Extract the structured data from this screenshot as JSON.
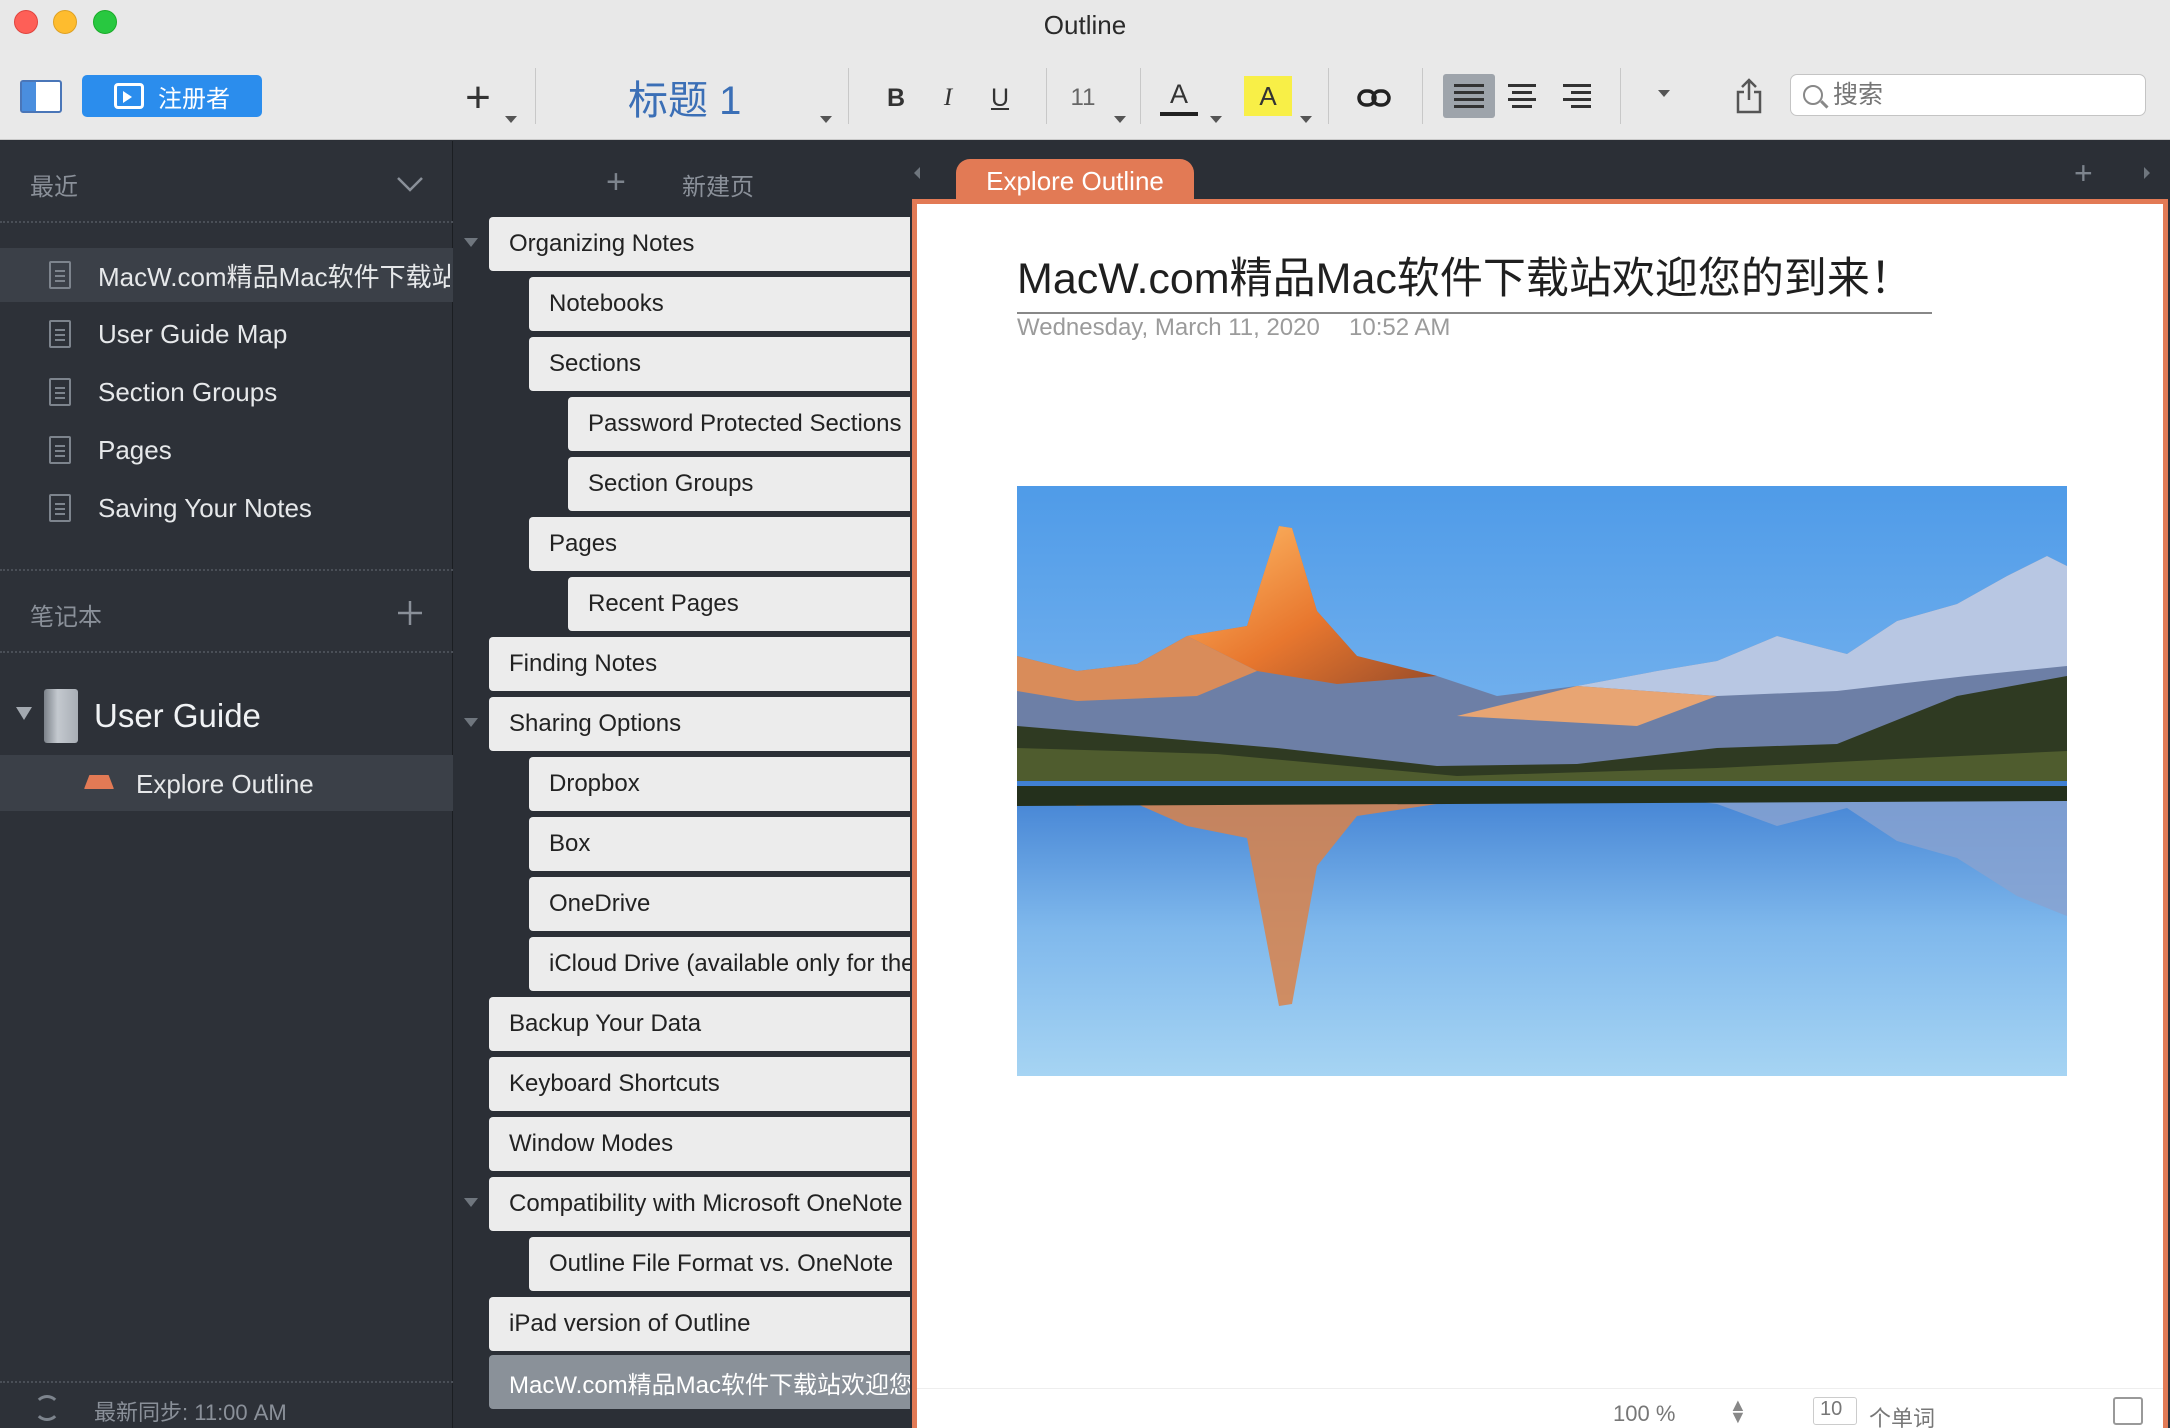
{
  "window": {
    "title": "Outline"
  },
  "toolbar": {
    "register_label": "注册者",
    "style_value": "标题 1",
    "bold_label": "B",
    "italic_label": "I",
    "underline_label": "U",
    "font_size": "11",
    "font_color_label": "A",
    "highlight_label": "A",
    "search_placeholder": "搜索",
    "highlight_color": "#f8ef47",
    "accent_color": "#2b8ded"
  },
  "sidebar": {
    "recent_header": "最近",
    "recent_items": [
      {
        "label": "MacW.com精品Mac软件下载站欢迎您的到来！"
      },
      {
        "label": "User Guide Map"
      },
      {
        "label": "Section Groups"
      },
      {
        "label": "Pages"
      },
      {
        "label": "Saving Your Notes"
      }
    ],
    "notebooks_header": "笔记本",
    "notebook": {
      "label": "User Guide"
    },
    "section": {
      "label": "Explore Outline",
      "color": "#e27a55"
    },
    "sync_status": "最新同步: 11:00 AM"
  },
  "pagelist": {
    "new_page_label": "新建页",
    "pages": [
      {
        "label": "Organizing Notes"
      },
      {
        "label": "Notebooks"
      },
      {
        "label": "Sections"
      },
      {
        "label": "Password Protected Sections"
      },
      {
        "label": "Section Groups"
      },
      {
        "label": "Pages"
      },
      {
        "label": "Recent Pages"
      },
      {
        "label": "Finding Notes"
      },
      {
        "label": "Sharing Options"
      },
      {
        "label": "Dropbox"
      },
      {
        "label": "Box"
      },
      {
        "label": "OneDrive"
      },
      {
        "label": "iCloud Drive (available only for the Mac App Store version)"
      },
      {
        "label": "Backup Your Data"
      },
      {
        "label": "Keyboard Shortcuts"
      },
      {
        "label": "Window Modes"
      },
      {
        "label": "Compatibility with Microsoft OneNote"
      },
      {
        "label": "Outline File Format vs. OneNote"
      },
      {
        "label": "iPad version of Outline"
      },
      {
        "label": "MacW.com精品Mac软件下载站欢迎您的到来！"
      }
    ]
  },
  "editor": {
    "tab_label": "Explore Outline",
    "page_title": "MacW.com精品Mac软件下载站欢迎您的到来！",
    "date": "Wednesday, March 11, 2020",
    "time": "10:52 AM",
    "zoom": "100 %",
    "word_count_value": "10",
    "word_count_label": "个单词"
  }
}
